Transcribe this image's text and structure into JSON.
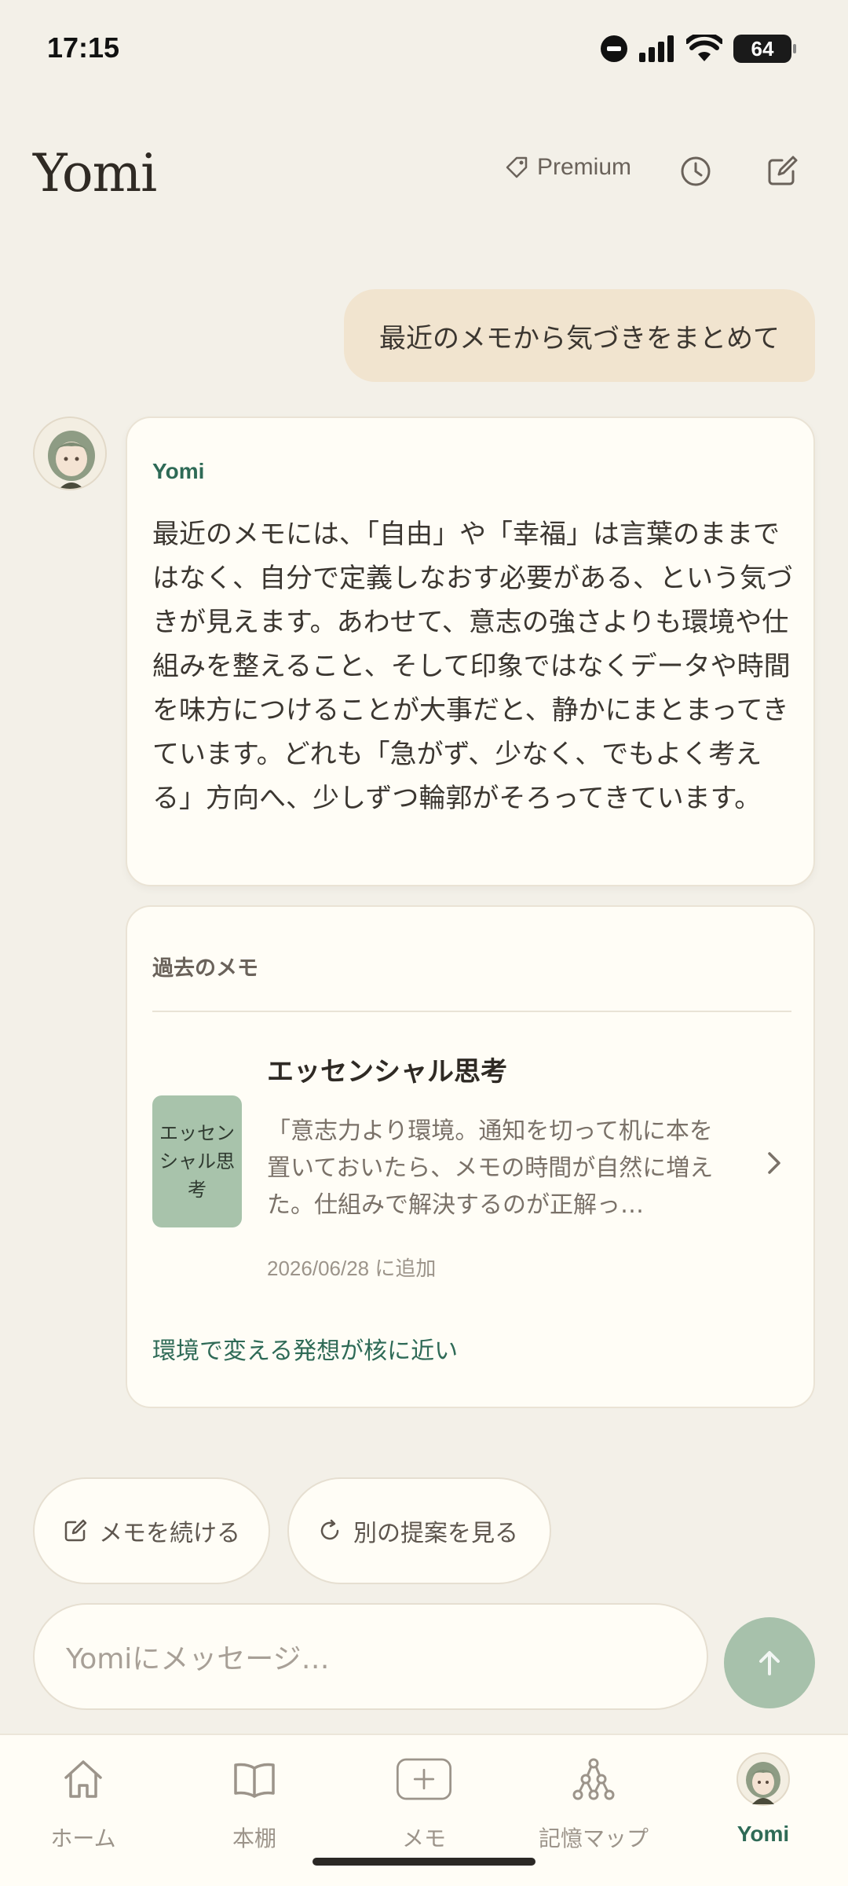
{
  "status_bar": {
    "time": "17:15",
    "battery": "64"
  },
  "header": {
    "title": "Yomi",
    "premium_label": "Premium",
    "history_icon": "clock-icon",
    "compose_icon": "edit-icon"
  },
  "chat": {
    "user_message": "最近のメモから気づきをまとめて",
    "ai_name": "Yomi",
    "ai_message": "最近のメモには、「自由」や「幸福」は言葉のままではなく、自分で定義しなおす必要がある、という気づきが見えます。あわせて、意志の強さよりも環境や仕組みを整えること、そして印象ではなくデータや時間を味方につけることが大事だと、静かにまとまってきています。どれも「急がず、少なく、でもよく考える」方向へ、少しずつ輪郭がそろってきています。"
  },
  "memo_card": {
    "heading": "過去のメモ",
    "book_cover_text": "エッセンシャル思考",
    "book_title": "エッセンシャル思考",
    "quote": "「意志力より環境。通知を切って机に本を置いておいたら、メモの時間が自然に増えた。仕組みで解決するのが正解っ…",
    "date": "2026/06/28 に追加",
    "insight": "環境で変える発想が核に近い"
  },
  "actions": {
    "continue_label": "メモを続ける",
    "suggest_label": "別の提案を見る"
  },
  "composer": {
    "placeholder": "Yomiにメッセージ…"
  },
  "tabs": [
    {
      "label": "ホーム",
      "icon": "home-icon"
    },
    {
      "label": "本棚",
      "icon": "book-icon"
    },
    {
      "label": "メモ",
      "icon": "plus-icon"
    },
    {
      "label": "記憶マップ",
      "icon": "graph-icon"
    },
    {
      "label": "Yomi",
      "icon": "avatar-icon",
      "active": true
    }
  ],
  "colors": {
    "background": "#F3F0E8",
    "accent_green": "#2E6A56",
    "user_bubble": "#F1E4CF",
    "send_button": "#A7C1AB",
    "book_cover": "#A8C3AB"
  }
}
